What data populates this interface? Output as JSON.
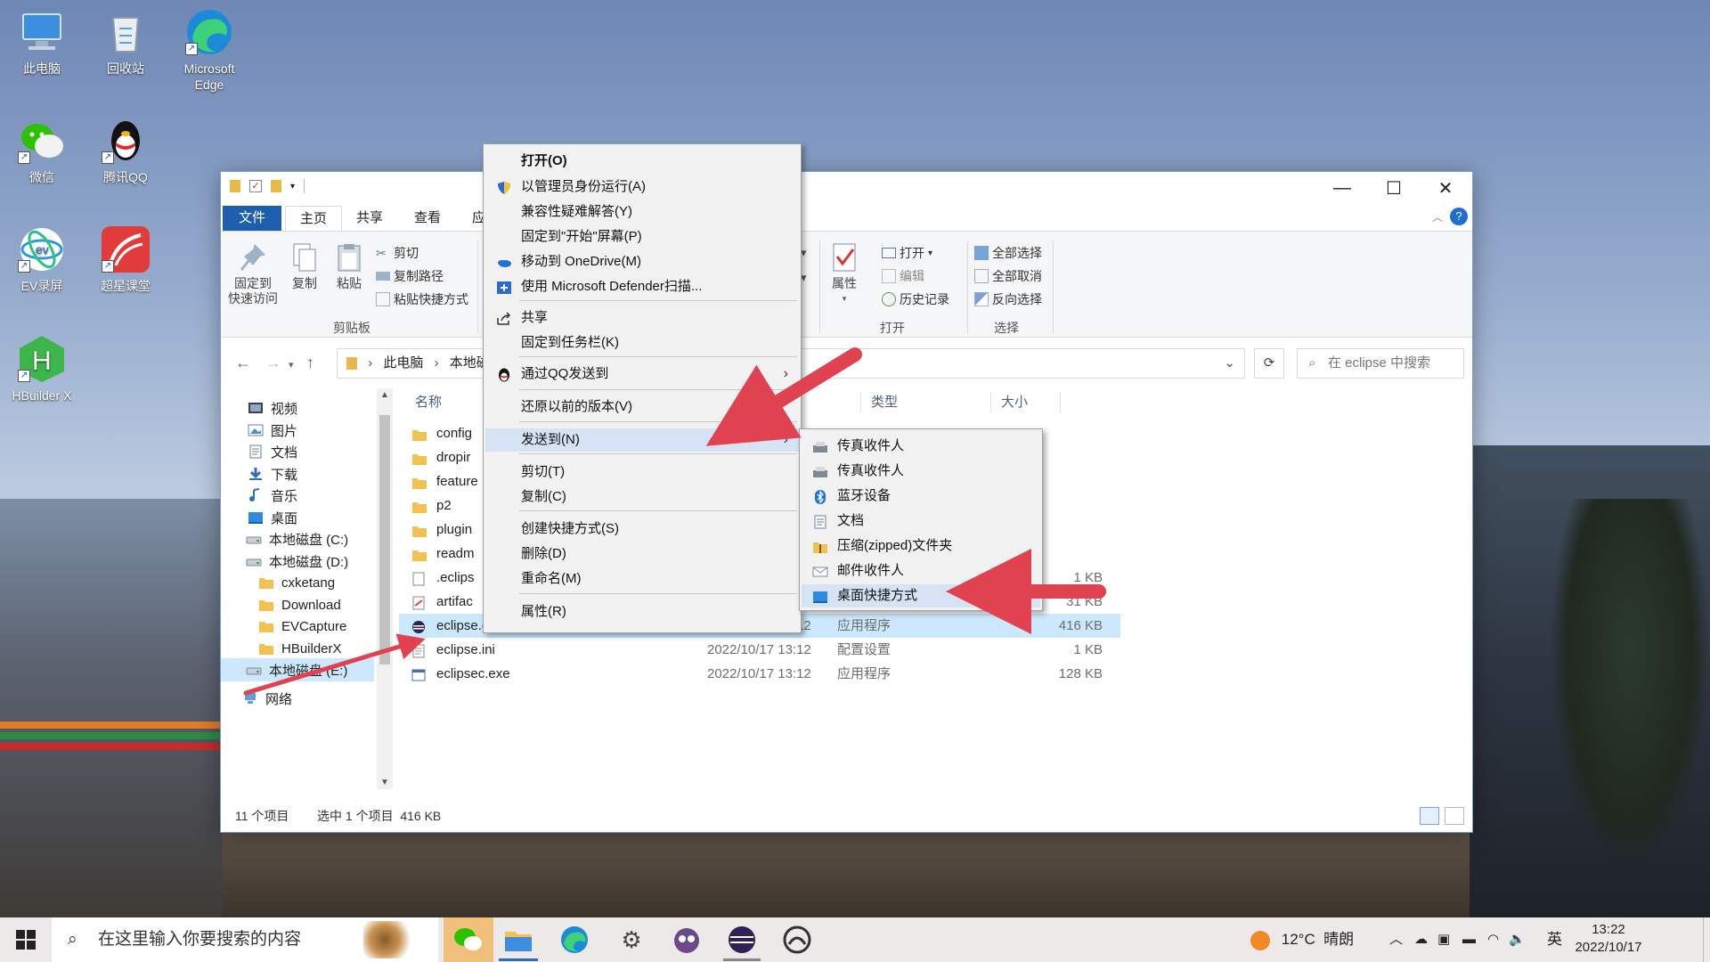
{
  "desktop": {
    "icons": [
      {
        "label": "此电脑",
        "icon": "computer-icon"
      },
      {
        "label": "回收站",
        "icon": "recycle-bin-icon"
      },
      {
        "label": "Microsoft Edge",
        "icon": "edge-icon"
      },
      {
        "label": "微信",
        "icon": "wechat-icon"
      },
      {
        "label": "腾讯QQ",
        "icon": "qq-icon"
      },
      {
        "label": "EV录屏",
        "icon": "ev-recorder-icon"
      },
      {
        "label": "超星课堂",
        "icon": "chaoxing-icon"
      },
      {
        "label": "HBuilder X",
        "icon": "hbuilder-icon"
      }
    ]
  },
  "window": {
    "controls": {
      "minimize": "—",
      "maximize": "☐",
      "close": "✕"
    },
    "tabs": [
      "文件",
      "主页",
      "共享",
      "查看",
      "应"
    ],
    "ribbon": {
      "pin_label": "固定到\n快速访问",
      "copy_label": "复制",
      "paste_label": "粘贴",
      "cut_label": "剪切",
      "copy_path_label": "复制路径",
      "paste_shortcut_label": "粘贴快捷方式",
      "clipboard_group": "剪贴板",
      "properties_label": "属性",
      "open_label": "打开",
      "edit_label": "编辑",
      "history_label": "历史记录",
      "open_group": "打开",
      "select_all_label": "全部选择",
      "select_none_label": "全部取消",
      "invert_selection_label": "反向选择",
      "select_group": "选择"
    },
    "address": {
      "crumb_1": "此电脑",
      "crumb_2": "本地磁",
      "search_placeholder": "在 eclipse 中搜索"
    },
    "nav_items": [
      {
        "label": "视频",
        "icon": "video-icon"
      },
      {
        "label": "图片",
        "icon": "pictures-icon"
      },
      {
        "label": "文档",
        "icon": "documents-icon"
      },
      {
        "label": "下载",
        "icon": "downloads-icon"
      },
      {
        "label": "音乐",
        "icon": "music-icon"
      },
      {
        "label": "桌面",
        "icon": "desktop-icon"
      },
      {
        "label": "本地磁盘 (C:)",
        "icon": "drive-icon"
      },
      {
        "label": "本地磁盘 (D:)",
        "icon": "drive-icon"
      },
      {
        "label": "cxketang",
        "icon": "folder-icon"
      },
      {
        "label": "Download",
        "icon": "folder-icon"
      },
      {
        "label": "EVCapture",
        "icon": "folder-icon"
      },
      {
        "label": "HBuilderX",
        "icon": "folder-icon"
      },
      {
        "label": "本地磁盘 (E:)",
        "icon": "drive-icon"
      },
      {
        "label": "网络",
        "icon": "network-icon"
      }
    ],
    "columns": {
      "name": "名称",
      "type": "类型",
      "size": "大小"
    },
    "files": [
      {
        "name": "config",
        "date": "",
        "type": "",
        "size": "",
        "icon": "folder-icon"
      },
      {
        "name": "dropir",
        "date": "",
        "type": "",
        "size": "",
        "icon": "folder-icon"
      },
      {
        "name": "feature",
        "date": "",
        "type": "",
        "size": "",
        "icon": "folder-icon"
      },
      {
        "name": "p2",
        "date": "",
        "type": "",
        "size": "",
        "icon": "folder-icon"
      },
      {
        "name": "plugin",
        "date": "",
        "type": "",
        "size": "",
        "icon": "folder-icon"
      },
      {
        "name": "readm",
        "date": "",
        "type": "",
        "size": "",
        "icon": "folder-icon"
      },
      {
        "name": ".eclips",
        "date": "",
        "type": "",
        "size": "1 KB",
        "icon": "file-icon"
      },
      {
        "name": "artifac",
        "date": "",
        "type": "",
        "size": "31 KB",
        "icon": "xml-file-icon"
      },
      {
        "name": "eclipse.exe",
        "date": "2022/10/17 13:12",
        "type": "应用程序",
        "size": "416 KB",
        "icon": "eclipse-icon"
      },
      {
        "name": "eclipse.ini",
        "date": "2022/10/17 13:12",
        "type": "配置设置",
        "size": "1 KB",
        "icon": "ini-file-icon"
      },
      {
        "name": "eclipsec.exe",
        "date": "2022/10/17 13:12",
        "type": "应用程序",
        "size": "128 KB",
        "icon": "exe-file-icon"
      }
    ],
    "status": {
      "count": "11 个项目",
      "selection": "选中 1 个项目  416 KB"
    }
  },
  "context_menu": {
    "items": [
      {
        "label": "打开(O)",
        "icon": ""
      },
      {
        "label": "以管理员身份运行(A)",
        "icon": "shield-icon"
      },
      {
        "label": "兼容性疑难解答(Y)",
        "icon": ""
      },
      {
        "label": "固定到\"开始\"屏幕(P)",
        "icon": ""
      },
      {
        "label": "移动到 OneDrive(M)",
        "icon": "onedrive-icon"
      },
      {
        "label": "使用 Microsoft Defender扫描...",
        "icon": "defender-icon"
      },
      {
        "label": "共享",
        "icon": "share-icon"
      },
      {
        "label": "固定到任务栏(K)",
        "icon": ""
      },
      {
        "label": "通过QQ发送到",
        "icon": "qq-icon"
      },
      {
        "label": "还原以前的版本(V)",
        "icon": ""
      },
      {
        "label": "发送到(N)",
        "icon": ""
      },
      {
        "label": "剪切(T)",
        "icon": ""
      },
      {
        "label": "复制(C)",
        "icon": ""
      },
      {
        "label": "创建快捷方式(S)",
        "icon": ""
      },
      {
        "label": "删除(D)",
        "icon": ""
      },
      {
        "label": "重命名(M)",
        "icon": ""
      },
      {
        "label": "属性(R)",
        "icon": ""
      }
    ]
  },
  "send_to_menu": {
    "items": [
      {
        "label": "传真收件人",
        "icon": "fax-icon"
      },
      {
        "label": "传真收件人",
        "icon": "fax-icon"
      },
      {
        "label": "蓝牙设备",
        "icon": "bluetooth-icon"
      },
      {
        "label": "文档",
        "icon": "documents-icon"
      },
      {
        "label": "压缩(zipped)文件夹",
        "icon": "zip-folder-icon"
      },
      {
        "label": "邮件收件人",
        "icon": "mail-icon"
      },
      {
        "label": "桌面快捷方式",
        "icon": "desktop-icon"
      }
    ]
  },
  "taskbar": {
    "search_placeholder": "在这里输入你要搜索的内容",
    "weather": "12°C  晴朗",
    "ime": "英",
    "time": "13:22",
    "date": "2022/10/17"
  },
  "colors": {
    "accent": "#1e5fad",
    "selection": "#cce8ff",
    "arrow": "#e0434f"
  }
}
